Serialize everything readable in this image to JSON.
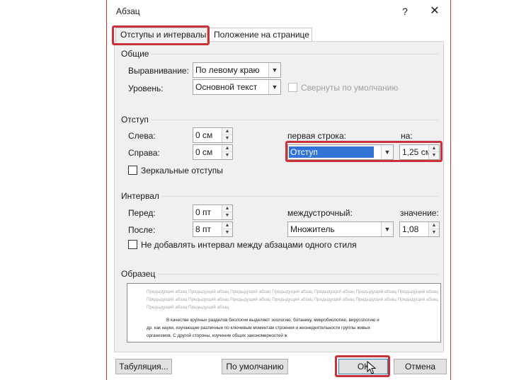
{
  "window": {
    "title": "Абзац",
    "help": "?",
    "close": "✕"
  },
  "tabs": [
    {
      "label": "Отступы и интервалы",
      "active": true
    },
    {
      "label": "Положение на странице",
      "active": false
    }
  ],
  "general": {
    "title": "Общие",
    "alignment_label": "Выравнивание:",
    "alignment_value": "По левому краю",
    "level_label": "Уровень:",
    "level_value": "Основной текст",
    "collapsed_label": "Свернуты по умолчанию"
  },
  "indent": {
    "title": "Отступ",
    "left_label": "Слева:",
    "left_value": "0 см",
    "right_label": "Справа:",
    "right_value": "0 см",
    "first_line_label": "первая строка:",
    "first_line_value": "Отступ",
    "by_label": "на:",
    "by_value": "1,25 см",
    "mirror_label": "Зеркальные отступы"
  },
  "spacing": {
    "title": "Интервал",
    "before_label": "Перед:",
    "before_value": "0 пт",
    "after_label": "После:",
    "after_value": "8 пт",
    "line_spacing_label": "междустрочный:",
    "line_spacing_value": "Множитель",
    "at_label": "значение:",
    "at_value": "1,08",
    "no_space_label": "Не добавлять интервал между абзацами одного стиля"
  },
  "preview": {
    "title": "Образец",
    "grey_lines": [
      "Предыдущий абзац Предыдущий абзац Предыдущий абзац Предыдущий абзац Предыдущий абзац Предыдущий абзац Предыдущий абзац",
      "Предыдущий абзац Предыдущий абзац Предыдущий абзац Предыдущий абзац Предыдущий абзац Предыдущий абзац Предыдущий абзац",
      "Предыдущий абзац Предыдущий абзац"
    ],
    "text_lines": [
      "В качестве крупных разделов биологии выделяют зоологию, ботанику, микробиологию, вирусологию и",
      "др. как науки, изучающие различные по ключевым моментам строения и жизнедеятельности группы живых",
      "организмов. С другой стороны, изучение общих закономерностей ж"
    ]
  },
  "buttons": {
    "tabs": "Табуляция...",
    "default": "По умолчанию",
    "ok": "ОК",
    "cancel": "Отмена"
  },
  "accent_color": "#c8323a",
  "selection_color": "#3274d6"
}
